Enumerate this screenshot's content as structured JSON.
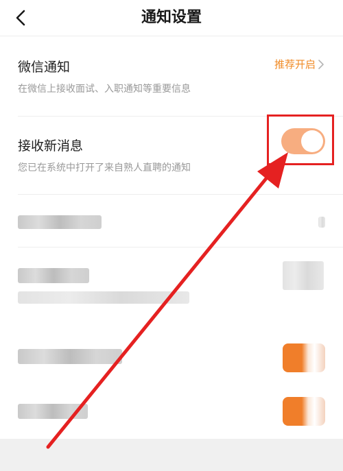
{
  "header": {
    "title": "通知设置",
    "back_icon": "chevron-left-icon"
  },
  "wechat": {
    "title": "微信通知",
    "subtitle": "在微信上接收面试、入职通知等重要信息",
    "action": "推荐开启",
    "action_icon": "chevron-right-icon"
  },
  "messages": {
    "title": "接收新消息",
    "subtitle": "您已在系统中打开了来自熟人直聘的通知",
    "toggle_state": "on"
  },
  "colors": {
    "accent": "#f08a24",
    "toggle_on": "#f7ad80",
    "annotation": "#e52121"
  }
}
